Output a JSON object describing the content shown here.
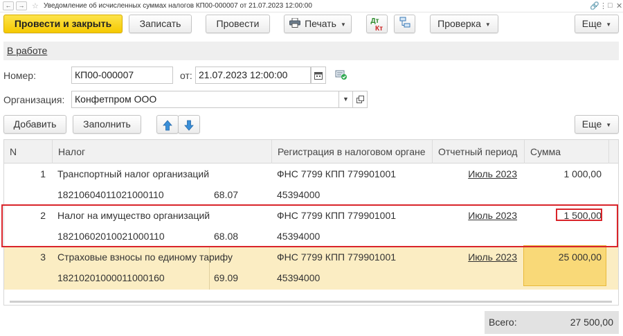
{
  "window": {
    "title": "Уведомление об исчисленных суммах налогов КП00-000007 от 21.07.2023 12:00:00"
  },
  "toolbar": {
    "post_and_close": "Провести и закрыть",
    "save": "Записать",
    "post": "Провести",
    "print": "Печать",
    "dt_kt_top": "Дт",
    "dt_kt_bottom": "Кт",
    "check": "Проверка",
    "more": "Еще"
  },
  "status": {
    "link": "В работе"
  },
  "form": {
    "number_label": "Номер:",
    "number_value": "КП00-000007",
    "date_label": "от:",
    "date_value": "21.07.2023 12:00:00",
    "org_label": "Организация:",
    "org_value": "Конфетпром ООО"
  },
  "table_toolbar": {
    "add": "Добавить",
    "fill": "Заполнить",
    "more": "Еще"
  },
  "table": {
    "columns": {
      "n": "N",
      "tax": "Налог",
      "registration": "Регистрация в налоговом органе",
      "period": "Отчетный период",
      "sum": "Сумма"
    },
    "rows": [
      {
        "n": "1",
        "tax": "Транспортный налог организаций",
        "kbk": "18210604011021000110",
        "account": "68.07",
        "registration": "ФНС 7799 КПП 779901001",
        "oktmo": "45394000",
        "period": "Июль 2023",
        "sum": "1 000,00"
      },
      {
        "n": "2",
        "tax": "Налог на имущество организаций",
        "kbk": "18210602010021000110",
        "account": "68.08",
        "registration": "ФНС 7799 КПП 779901001",
        "oktmo": "45394000",
        "period": "Июль 2023",
        "sum": "1 500,00"
      },
      {
        "n": "3",
        "tax": "Страховые взносы по единому тарифу",
        "kbk": "18210201000011000160",
        "account": "69.09",
        "registration": "ФНС 7799 КПП 779901001",
        "oktmo": "45394000",
        "period": "Июль 2023",
        "sum": "25 000,00"
      }
    ]
  },
  "total": {
    "label": "Всего:",
    "value": "27 500,00"
  },
  "colors": {
    "primary_button": "#f5c900",
    "selected_row": "#fbedc3",
    "highlight_border": "#d9242a",
    "arrow_blue": "#3a8fd8"
  }
}
